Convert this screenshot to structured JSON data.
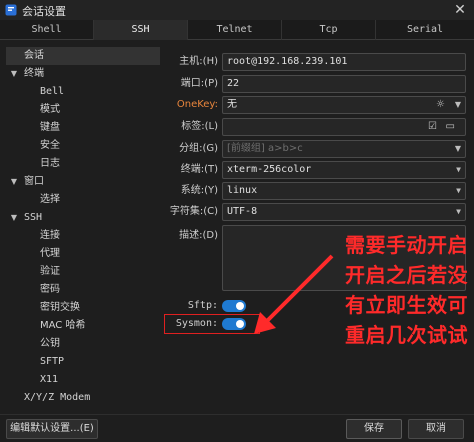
{
  "window": {
    "title": "会话设置",
    "close_glyph": "✕"
  },
  "tabs": [
    {
      "label": "Shell"
    },
    {
      "label": "SSH"
    },
    {
      "label": "Telnet"
    },
    {
      "label": "Tcp"
    },
    {
      "label": "Serial"
    }
  ],
  "sidebar": {
    "items": [
      {
        "label": "会话"
      },
      {
        "label": "终端"
      },
      {
        "label": "Bell"
      },
      {
        "label": "模式"
      },
      {
        "label": "键盘"
      },
      {
        "label": "安全"
      },
      {
        "label": "日志"
      },
      {
        "label": "窗口"
      },
      {
        "label": "选择"
      },
      {
        "label": "SSH"
      },
      {
        "label": "连接"
      },
      {
        "label": "代理"
      },
      {
        "label": "验证"
      },
      {
        "label": "密码"
      },
      {
        "label": "密钥交换"
      },
      {
        "label": "MAC 哈希"
      },
      {
        "label": "公钥"
      },
      {
        "label": "SFTP"
      },
      {
        "label": "X11"
      },
      {
        "label": "X/Y/Z Modem"
      }
    ]
  },
  "form": {
    "host_label": "主机:(H)",
    "host_value": "root@192.168.239.101",
    "port_label": "端口:(P)",
    "port_value": "22",
    "onekey_label": "OneKey:",
    "onekey_value": "无",
    "tag_label": "标签:(L)",
    "group_label": "分组:(G)",
    "group_placeholder": "[前缀组] a>b>c",
    "terminal_label": "终端:(T)",
    "terminal_value": "xterm-256color",
    "system_label": "系统:(Y)",
    "system_value": "linux",
    "charset_label": "字符集:(C)",
    "charset_value": "UTF-8",
    "desc_label": "描述:(D)",
    "sftp_label": "Sftp:",
    "sftp_on": true,
    "sysmon_label": "Sysmon:",
    "sysmon_on": true
  },
  "annotation": {
    "lines": [
      "需要手动开启",
      "开启之后若没",
      "有立即生效可",
      "重启几次试试"
    ],
    "color": "#ff2a2a"
  },
  "footer": {
    "edit_default_label": "编辑默认设置...(E)",
    "save_label": "保存",
    "cancel_label": "取消"
  },
  "colors": {
    "accent": "#1f7ad1",
    "onekey_label": "#e8853c"
  }
}
